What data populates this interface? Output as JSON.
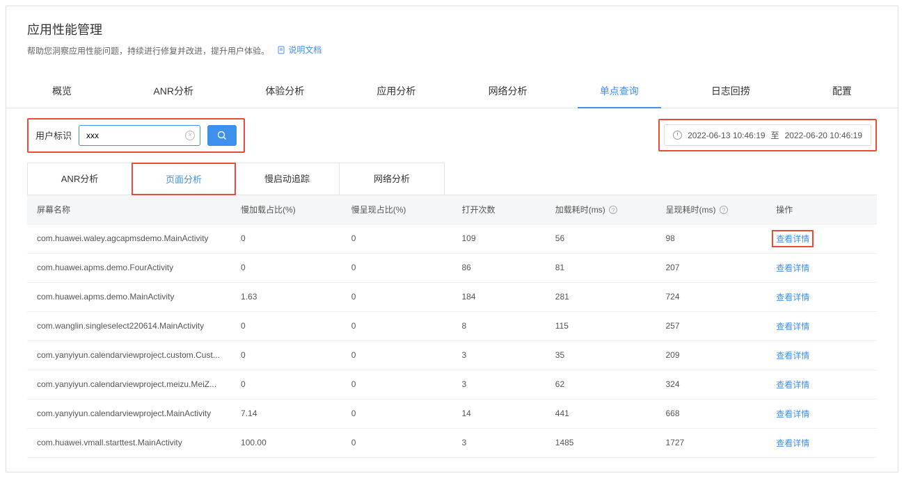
{
  "header": {
    "title": "应用性能管理",
    "description": "帮助您洞察应用性能问题，持续进行修复并改进，提升用户体验。",
    "doc_link": "说明文档"
  },
  "main_tabs": [
    "概览",
    "ANR分析",
    "体验分析",
    "应用分析",
    "网络分析",
    "单点查询",
    "日志回捞",
    "配置"
  ],
  "main_tab_active": 5,
  "filter": {
    "label": "用户标识",
    "value": "xxx",
    "date_from": "2022-06-13 10:46:19",
    "date_sep": "至",
    "date_to": "2022-06-20 10:46:19"
  },
  "sub_tabs": [
    "ANR分析",
    "页面分析",
    "慢启动追踪",
    "网络分析"
  ],
  "sub_tab_active": 1,
  "table": {
    "headers": {
      "screen": "屏幕名称",
      "slow_load": "慢加载占比(%)",
      "slow_render": "慢呈现占比(%)",
      "open_count": "打开次数",
      "load_time": "加载耗时(ms)",
      "render_time": "呈现耗时(ms)",
      "action": "操作"
    },
    "action_label": "查看详情",
    "rows": [
      {
        "screen": "com.huawei.waley.agcapmsdemo.MainActivity",
        "slow_load": "0",
        "slow_render": "0",
        "open": "109",
        "load": "56",
        "render": "98",
        "highlighted": true
      },
      {
        "screen": "com.huawei.apms.demo.FourActivity",
        "slow_load": "0",
        "slow_render": "0",
        "open": "86",
        "load": "81",
        "render": "207"
      },
      {
        "screen": "com.huawei.apms.demo.MainActivity",
        "slow_load": "1.63",
        "slow_render": "0",
        "open": "184",
        "load": "281",
        "render": "724"
      },
      {
        "screen": "com.wanglin.singleselect220614.MainActivity",
        "slow_load": "0",
        "slow_render": "0",
        "open": "8",
        "load": "115",
        "render": "257"
      },
      {
        "screen": "com.yanyiyun.calendarviewproject.custom.Cust...",
        "slow_load": "0",
        "slow_render": "0",
        "open": "3",
        "load": "35",
        "render": "209"
      },
      {
        "screen": "com.yanyiyun.calendarviewproject.meizu.MeiZ...",
        "slow_load": "0",
        "slow_render": "0",
        "open": "3",
        "load": "62",
        "render": "324"
      },
      {
        "screen": "com.yanyiyun.calendarviewproject.MainActivity",
        "slow_load": "7.14",
        "slow_render": "0",
        "open": "14",
        "load": "441",
        "render": "668"
      },
      {
        "screen": "com.huawei.vmall.starttest.MainActivity",
        "slow_load": "100.00",
        "slow_render": "0",
        "open": "3",
        "load": "1485",
        "render": "1727"
      }
    ]
  }
}
